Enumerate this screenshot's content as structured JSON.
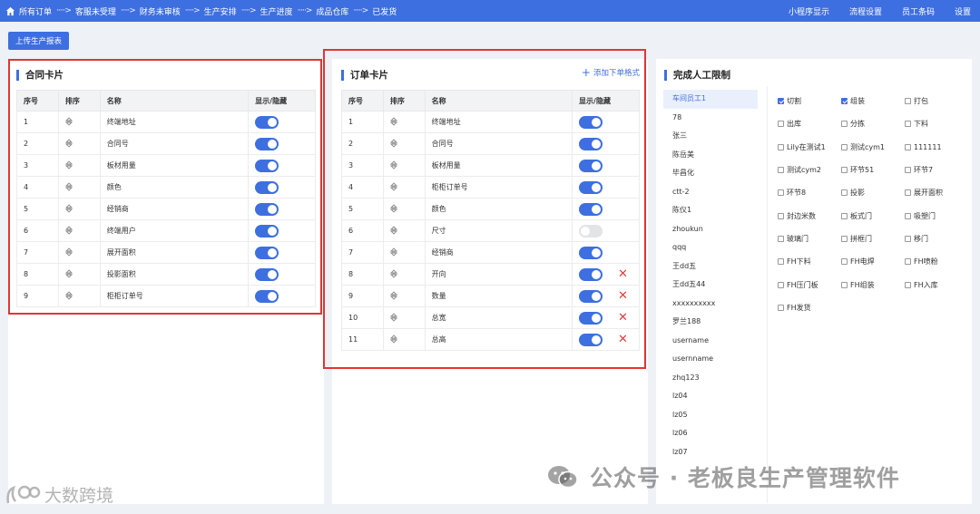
{
  "topbar": {
    "breadcrumbs": [
      "所有订单",
      "客服未受理",
      "财务未审核",
      "生产安排",
      "生产进度",
      "成品仓库",
      "已发货"
    ],
    "separator": "·····>",
    "right_links": [
      "小程序显示",
      "流程设置",
      "员工条码",
      "设置"
    ]
  },
  "toolbar": {
    "upload_label": "上传生产报表"
  },
  "contract_card": {
    "title": "合同卡片",
    "headers": [
      "序号",
      "排序",
      "名称",
      "显示/隐藏"
    ],
    "rows": [
      {
        "no": "1",
        "name": "终端地址",
        "visible": true
      },
      {
        "no": "2",
        "name": "合同号",
        "visible": true
      },
      {
        "no": "3",
        "name": "板材用量",
        "visible": true
      },
      {
        "no": "4",
        "name": "颜色",
        "visible": true
      },
      {
        "no": "5",
        "name": "经销商",
        "visible": true
      },
      {
        "no": "6",
        "name": "终端用户",
        "visible": true
      },
      {
        "no": "7",
        "name": "展开面积",
        "visible": true
      },
      {
        "no": "8",
        "name": "投影面积",
        "visible": true
      },
      {
        "no": "9",
        "name": "柜柜订单号",
        "visible": true
      }
    ]
  },
  "order_card": {
    "title": "订单卡片",
    "add_link": "添加下单格式",
    "headers": [
      "序号",
      "排序",
      "名称",
      "显示/隐藏"
    ],
    "rows": [
      {
        "no": "1",
        "name": "终端地址",
        "visible": true,
        "deletable": false
      },
      {
        "no": "2",
        "name": "合同号",
        "visible": true,
        "deletable": false
      },
      {
        "no": "3",
        "name": "板材用量",
        "visible": true,
        "deletable": false
      },
      {
        "no": "4",
        "name": "柜柜订单号",
        "visible": true,
        "deletable": false
      },
      {
        "no": "5",
        "name": "颜色",
        "visible": true,
        "deletable": false
      },
      {
        "no": "6",
        "name": "尺寸",
        "visible": false,
        "deletable": false
      },
      {
        "no": "7",
        "name": "经销商",
        "visible": true,
        "deletable": false
      },
      {
        "no": "8",
        "name": "开向",
        "visible": true,
        "deletable": true
      },
      {
        "no": "9",
        "name": "数量",
        "visible": true,
        "deletable": true
      },
      {
        "no": "10",
        "name": "总宽",
        "visible": true,
        "deletable": true
      },
      {
        "no": "11",
        "name": "总高",
        "visible": true,
        "deletable": true
      }
    ]
  },
  "labor_limit": {
    "title": "完成人工限制",
    "staff": [
      "车间员工1",
      "78",
      "张三",
      "陈岳美",
      "毕昌化",
      "ctt-2",
      "陈仪1",
      "zhoukun",
      "qqq",
      "王dd五",
      "王dd五44",
      "xxxxxxxxxx",
      "罗兰188",
      "username",
      "usernname",
      "zhq123",
      "lz04",
      "lz05",
      "lz06",
      "lz07"
    ],
    "active_staff": 0,
    "permissions": [
      {
        "label": "切割",
        "checked": true
      },
      {
        "label": "组装",
        "checked": true
      },
      {
        "label": "打包",
        "checked": false
      },
      {
        "label": "出库",
        "checked": false
      },
      {
        "label": "分拣",
        "checked": false
      },
      {
        "label": "下料",
        "checked": false
      },
      {
        "label": "Lily在测试1",
        "checked": false
      },
      {
        "label": "测试cym1",
        "checked": false
      },
      {
        "label": "111111",
        "checked": false
      },
      {
        "label": "测试cym2",
        "checked": false
      },
      {
        "label": "环节51",
        "checked": false
      },
      {
        "label": "环节7",
        "checked": false
      },
      {
        "label": "环节8",
        "checked": false
      },
      {
        "label": "投影",
        "checked": false
      },
      {
        "label": "展开面积",
        "checked": false
      },
      {
        "label": "封边米数",
        "checked": false
      },
      {
        "label": "板式门",
        "checked": false
      },
      {
        "label": "吸塑门",
        "checked": false
      },
      {
        "label": "玻璃门",
        "checked": false
      },
      {
        "label": "拼框门",
        "checked": false
      },
      {
        "label": "移门",
        "checked": false
      },
      {
        "label": "FH下料",
        "checked": false
      },
      {
        "label": "FH电焊",
        "checked": false
      },
      {
        "label": "FH喷粉",
        "checked": false
      },
      {
        "label": "FH压门板",
        "checked": false
      },
      {
        "label": "FH组装",
        "checked": false
      },
      {
        "label": "FH入库",
        "checked": false
      },
      {
        "label": "FH发货",
        "checked": false
      }
    ]
  },
  "watermarks": {
    "wechat": "公众号 · 老板良生产管理软件",
    "logo": "大数跨境"
  },
  "colors": {
    "primary": "#3d6fe0",
    "highlight_box": "#e03535",
    "delete": "#e23b3b"
  }
}
